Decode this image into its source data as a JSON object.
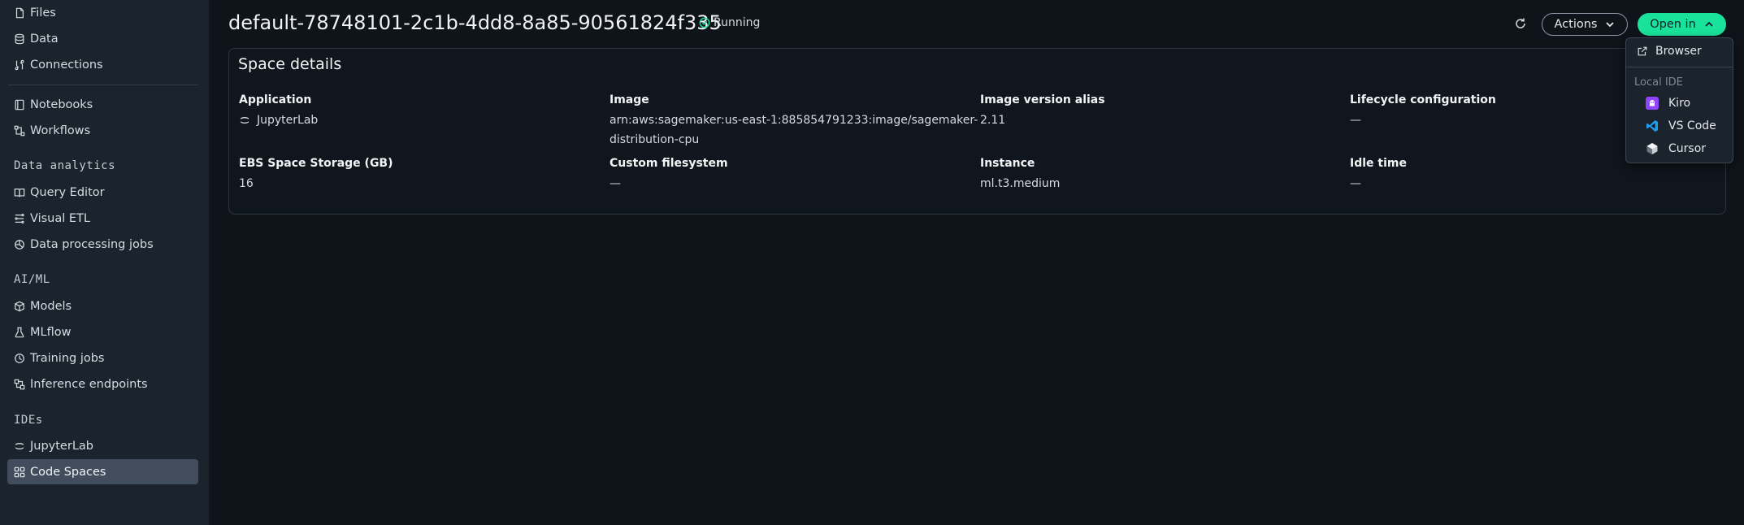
{
  "sidebar": {
    "top_items": [
      {
        "label": "Files",
        "icon": "file-icon"
      },
      {
        "label": "Data",
        "icon": "database-icon"
      },
      {
        "label": "Connections",
        "icon": "connection-icon"
      }
    ],
    "build_items": [
      {
        "label": "Notebooks",
        "icon": "notebook-icon"
      },
      {
        "label": "Workflows",
        "icon": "workflow-icon"
      }
    ],
    "data_analytics": {
      "title": "Data analytics",
      "items": [
        {
          "label": "Query Editor",
          "icon": "book-icon"
        },
        {
          "label": "Visual ETL",
          "icon": "etl-icon"
        },
        {
          "label": "Data processing jobs",
          "icon": "processing-icon"
        }
      ]
    },
    "aiml": {
      "title": "AI/ML",
      "items": [
        {
          "label": "Models",
          "icon": "cube-icon"
        },
        {
          "label": "MLflow",
          "icon": "flask-icon"
        },
        {
          "label": "Training jobs",
          "icon": "training-icon"
        },
        {
          "label": "Inference endpoints",
          "icon": "endpoint-icon"
        }
      ]
    },
    "ides": {
      "title": "IDEs",
      "items": [
        {
          "label": "JupyterLab",
          "icon": "jupyter-icon"
        },
        {
          "label": "Code Spaces",
          "icon": "grid-icon",
          "active": true
        }
      ]
    }
  },
  "header": {
    "title": "default-78748101-2c1b-4dd8-8a85-90561824f335",
    "status": "Running",
    "status_color": "#19e39b",
    "actions_label": "Actions",
    "open_in_label": "Open in",
    "accent_color": "#19e39b"
  },
  "details": {
    "title": "Space details",
    "fields": {
      "application": {
        "label": "Application",
        "value": "JupyterLab"
      },
      "image": {
        "label": "Image",
        "value_line1": "arn:aws:sagemaker:us-east-1:885854791233:image/sagemaker-",
        "value_line2": "distribution-cpu"
      },
      "image_version_alias": {
        "label": "Image version alias",
        "value": "2.11"
      },
      "lifecycle_configuration": {
        "label": "Lifecycle configuration",
        "value": "—"
      },
      "ebs_storage": {
        "label": "EBS Space Storage (GB)",
        "value": "16"
      },
      "custom_filesystem": {
        "label": "Custom filesystem",
        "value": "—"
      },
      "instance": {
        "label": "Instance",
        "value": "ml.t3.medium"
      },
      "idle_time": {
        "label": "Idle time",
        "value": "—"
      }
    }
  },
  "open_in_menu": {
    "browser": {
      "label": "Browser",
      "icon": "external-link-icon"
    },
    "group_title": "Local IDE",
    "ides": [
      {
        "label": "Kiro",
        "icon": "kiro-icon"
      },
      {
        "label": "VS Code",
        "icon": "vscode-icon"
      },
      {
        "label": "Cursor",
        "icon": "cursor-icon"
      }
    ]
  }
}
